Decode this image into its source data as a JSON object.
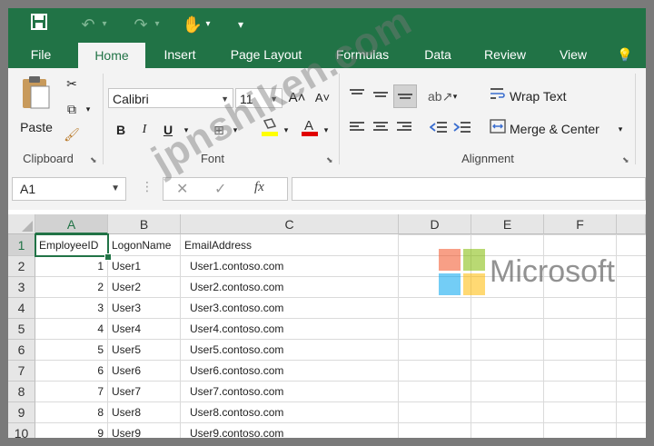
{
  "colors": {
    "accent": "#217346",
    "ribbon": "#f3f3f3",
    "ms_red": "#f25022",
    "ms_green": "#7fba00",
    "ms_blue": "#00a4ef",
    "ms_yellow": "#ffb900"
  },
  "quick_access": {
    "save_icon": "save-icon",
    "undo_icon": "undo-icon",
    "redo_icon": "redo-icon",
    "touch_icon": "touch-mode-icon",
    "customize_icon": "customize-qat-icon"
  },
  "tabs": [
    {
      "label": "File"
    },
    {
      "label": "Home"
    },
    {
      "label": "Insert"
    },
    {
      "label": "Page Layout"
    },
    {
      "label": "Formulas"
    },
    {
      "label": "Data"
    },
    {
      "label": "Review"
    },
    {
      "label": "View"
    }
  ],
  "tell_me_icon": "lightbulb-icon",
  "ribbon": {
    "clipboard": {
      "paste_label": "Paste",
      "group_label": "Clipboard"
    },
    "font": {
      "font_name": "Calibri",
      "font_size": "11",
      "bold": "B",
      "italic": "I",
      "underline": "U",
      "group_label": "Font"
    },
    "alignment": {
      "wrap_text": "Wrap Text",
      "merge_center": "Merge & Center",
      "group_label": "Alignment"
    }
  },
  "formula_bar": {
    "name_box": "A1",
    "fx": "fx",
    "formula": ""
  },
  "columns": [
    "A",
    "B",
    "C",
    "D",
    "E",
    "F"
  ],
  "rows": [
    "1",
    "2",
    "3",
    "4",
    "5",
    "6",
    "7",
    "8",
    "9",
    "10"
  ],
  "table": {
    "headers": [
      "EmployeeID",
      "LogonName",
      "EmailAddress"
    ],
    "data": [
      [
        "1",
        "User1",
        "User1.contoso.com"
      ],
      [
        "2",
        "User2",
        "User2.contoso.com"
      ],
      [
        "3",
        "User3",
        "User3.contoso.com"
      ],
      [
        "4",
        "User4",
        "User4.contoso.com"
      ],
      [
        "5",
        "User5",
        "User5.contoso.com"
      ],
      [
        "6",
        "User6",
        "User6.contoso.com"
      ],
      [
        "7",
        "User7",
        "User7.contoso.com"
      ],
      [
        "8",
        "User8",
        "User8.contoso.com"
      ],
      [
        "9",
        "User9",
        "User9.contoso.com"
      ]
    ]
  },
  "logo_text": "Microsoft",
  "watermark": "jpnshiken.com"
}
